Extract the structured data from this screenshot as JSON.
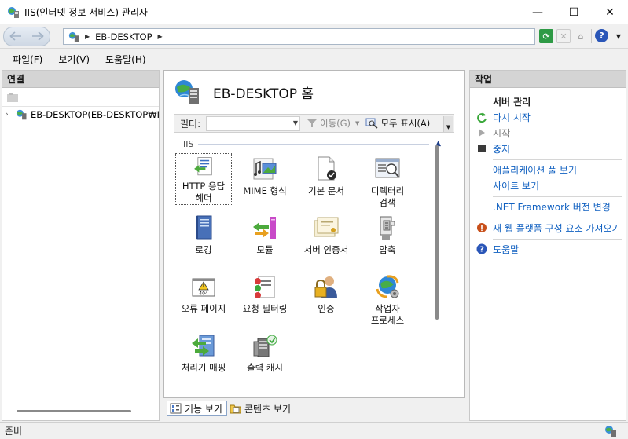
{
  "window": {
    "title": "IIS(인터넷 정보 서비스) 관리자",
    "minimize_glyph": "—",
    "maximize_glyph": "☐",
    "close_glyph": "✕"
  },
  "address": {
    "crumbs": [
      "EB-DESKTOP"
    ],
    "separator": "▶"
  },
  "menu": [
    "파일(F)",
    "보기(V)",
    "도움말(H)"
  ],
  "connections": {
    "title": "연결",
    "tree": [
      {
        "label": "EB-DESKTOP(EB-DESKTOP₩I",
        "expander": "›",
        "icon": "server-icon"
      }
    ]
  },
  "center": {
    "title": "EB-DESKTOP 홈",
    "filter_label": "필터:",
    "filter_value": "",
    "go_label": "이동(G)",
    "show_all_label": "모두 표시(A)",
    "group_label": "IIS",
    "group_toggle_glyph": "▲",
    "features": [
      {
        "label": "HTTP 응답\n헤더",
        "icon": "http-response-headers-icon",
        "selected": true
      },
      {
        "label": "MIME 형식",
        "icon": "mime-types-icon"
      },
      {
        "label": "기본 문서",
        "icon": "default-document-icon"
      },
      {
        "label": "디렉터리\n검색",
        "icon": "directory-browsing-icon"
      },
      {
        "label": "로깅",
        "icon": "logging-icon"
      },
      {
        "label": "모듈",
        "icon": "modules-icon"
      },
      {
        "label": "서버 인증서",
        "icon": "server-certificates-icon"
      },
      {
        "label": "압축",
        "icon": "compression-icon"
      },
      {
        "label": "오류 페이지",
        "icon": "error-pages-icon"
      },
      {
        "label": "요청 필터링",
        "icon": "request-filtering-icon"
      },
      {
        "label": "인증",
        "icon": "authentication-icon"
      },
      {
        "label": "작업자\n프로세스",
        "icon": "worker-processes-icon"
      },
      {
        "label": "처리기 매핑",
        "icon": "handler-mappings-icon"
      },
      {
        "label": "출력 캐시",
        "icon": "output-caching-icon"
      }
    ]
  },
  "view_tabs": [
    {
      "label": "기능 보기",
      "active": true,
      "icon": "features-view-icon"
    },
    {
      "label": "콘텐츠 보기",
      "active": false,
      "icon": "content-view-icon"
    }
  ],
  "actions": {
    "title": "작업",
    "server_section": "서버 관리",
    "items": [
      {
        "label": "다시 시작",
        "icon": "restart-icon",
        "enabled": true
      },
      {
        "label": "시작",
        "icon": "start-icon",
        "enabled": false
      },
      {
        "label": "중지",
        "icon": "stop-icon",
        "enabled": true
      },
      {
        "label": "애플리케이션 풀 보기",
        "enabled": true
      },
      {
        "label": "사이트 보기",
        "enabled": true
      },
      {
        "label": ".NET Framework 버전 변경",
        "enabled": true
      },
      {
        "label": "새 웹 플랫폼 구성 요소 가져오기",
        "icon": "web-platform-icon",
        "enabled": true
      },
      {
        "label": "도움말",
        "icon": "help-icon",
        "enabled": true
      }
    ]
  },
  "status": {
    "text": "준비"
  }
}
